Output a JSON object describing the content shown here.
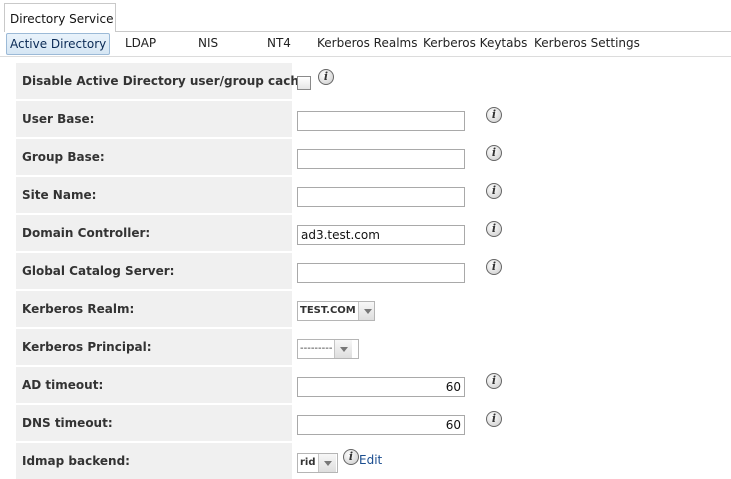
{
  "top_tab": {
    "label": "Directory Service"
  },
  "subtabs": [
    {
      "label": "Active Directory"
    },
    {
      "label": "LDAP"
    },
    {
      "label": "NIS"
    },
    {
      "label": "NT4"
    },
    {
      "label": "Kerberos Realms"
    },
    {
      "label": "Kerberos Keytabs"
    },
    {
      "label": "Kerberos Settings"
    }
  ],
  "form": {
    "disable_cache": {
      "label": "Disable Active Directory user/group cache:",
      "checked": false
    },
    "user_base": {
      "label": "User Base:",
      "value": ""
    },
    "group_base": {
      "label": "Group Base:",
      "value": ""
    },
    "site_name": {
      "label": "Site Name:",
      "value": ""
    },
    "domain_controller": {
      "label": "Domain Controller:",
      "value": "ad3.test.com"
    },
    "global_catalog": {
      "label": "Global Catalog Server:",
      "value": ""
    },
    "kerberos_realm": {
      "label": "Kerberos Realm:",
      "value": "TEST.COM"
    },
    "kerberos_principal": {
      "label": "Kerberos Principal:",
      "value": "---------"
    },
    "ad_timeout": {
      "label": "AD timeout:",
      "value": "60"
    },
    "dns_timeout": {
      "label": "DNS timeout:",
      "value": "60"
    },
    "idmap_backend": {
      "label": "Idmap backend:",
      "value": "rid",
      "edit_label": "Edit"
    }
  },
  "icons": {
    "info": "info-icon",
    "dropdown": "chevron-down-icon"
  },
  "info_glyph": "i"
}
